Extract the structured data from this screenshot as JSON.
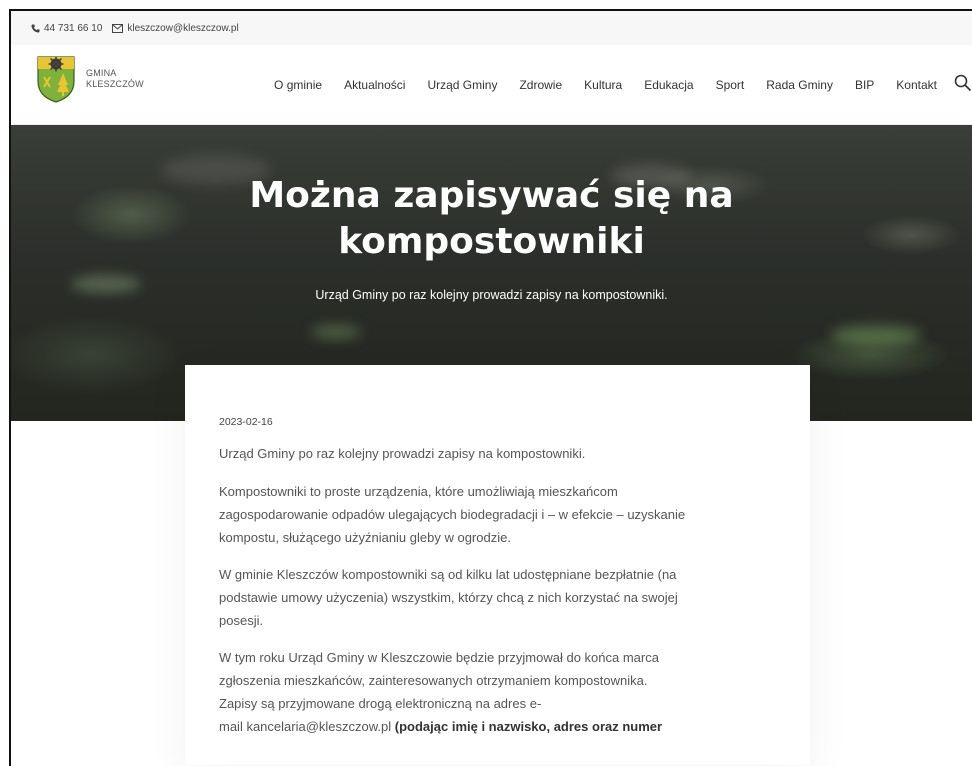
{
  "topbar": {
    "phone": "44 731 66 10",
    "email": "kleszczow@kleszczow.pl",
    "phone_icon": "phone-icon",
    "email_icon": "envelope-icon"
  },
  "logo": {
    "line1": "GMINA",
    "line2": "KLESZCZÓW"
  },
  "nav": {
    "items": [
      "O gminie",
      "Aktualności",
      "Urząd Gminy",
      "Zdrowie",
      "Kultura",
      "Edukacja",
      "Sport",
      "Rada Gminy",
      "BIP",
      "Kontakt"
    ],
    "search_icon": "search-icon"
  },
  "hero": {
    "title_line1": "Można zapisywać się na",
    "title_line2": "kompostowniki",
    "subtitle": "Urząd Gminy po raz kolejny prowadzi zapisy na kompostowniki."
  },
  "article": {
    "date": "2023-02-16",
    "p1": "Urząd Gminy po raz kolejny prowadzi zapisy na kompostowniki.",
    "p2_l1": "Kompostowniki to proste urządzenia, które umożliwiają mieszkańcom",
    "p2_l2": "zagospodarowanie odpadów ulegających biodegradacji i – w efekcie – uzyskanie",
    "p2_l3": "kompostu, służącego użyźnianiu gleby w ogrodzie.",
    "p3_l1": "W gminie Kleszczów kompostowniki są od kilku lat udostępniane bezpłatnie (na",
    "p3_l2": "podstawie umowy użyczenia) wszystkim, którzy chcą z nich korzystać na swojej",
    "p3_l3": "posesji.",
    "p4_l1": "W tym roku Urząd Gminy w Kleszczowie będzie przyjmował do końca marca",
    "p4_l2": "zgłoszenia mieszkańców, zainteresowanych otrzymaniem kompostownika.",
    "p4_l3": "Zapisy są przyjmowane drogą elektroniczną na adres e-",
    "p4_l4a": "mail ",
    "p4_l4_link": "kancelaria@kleszczow.pl",
    "p4_l4b": " (podając imię i nazwisko, adres oraz numer"
  },
  "colors": {
    "hero_dark": "#2b2e2a",
    "accent_link": "#333333"
  }
}
